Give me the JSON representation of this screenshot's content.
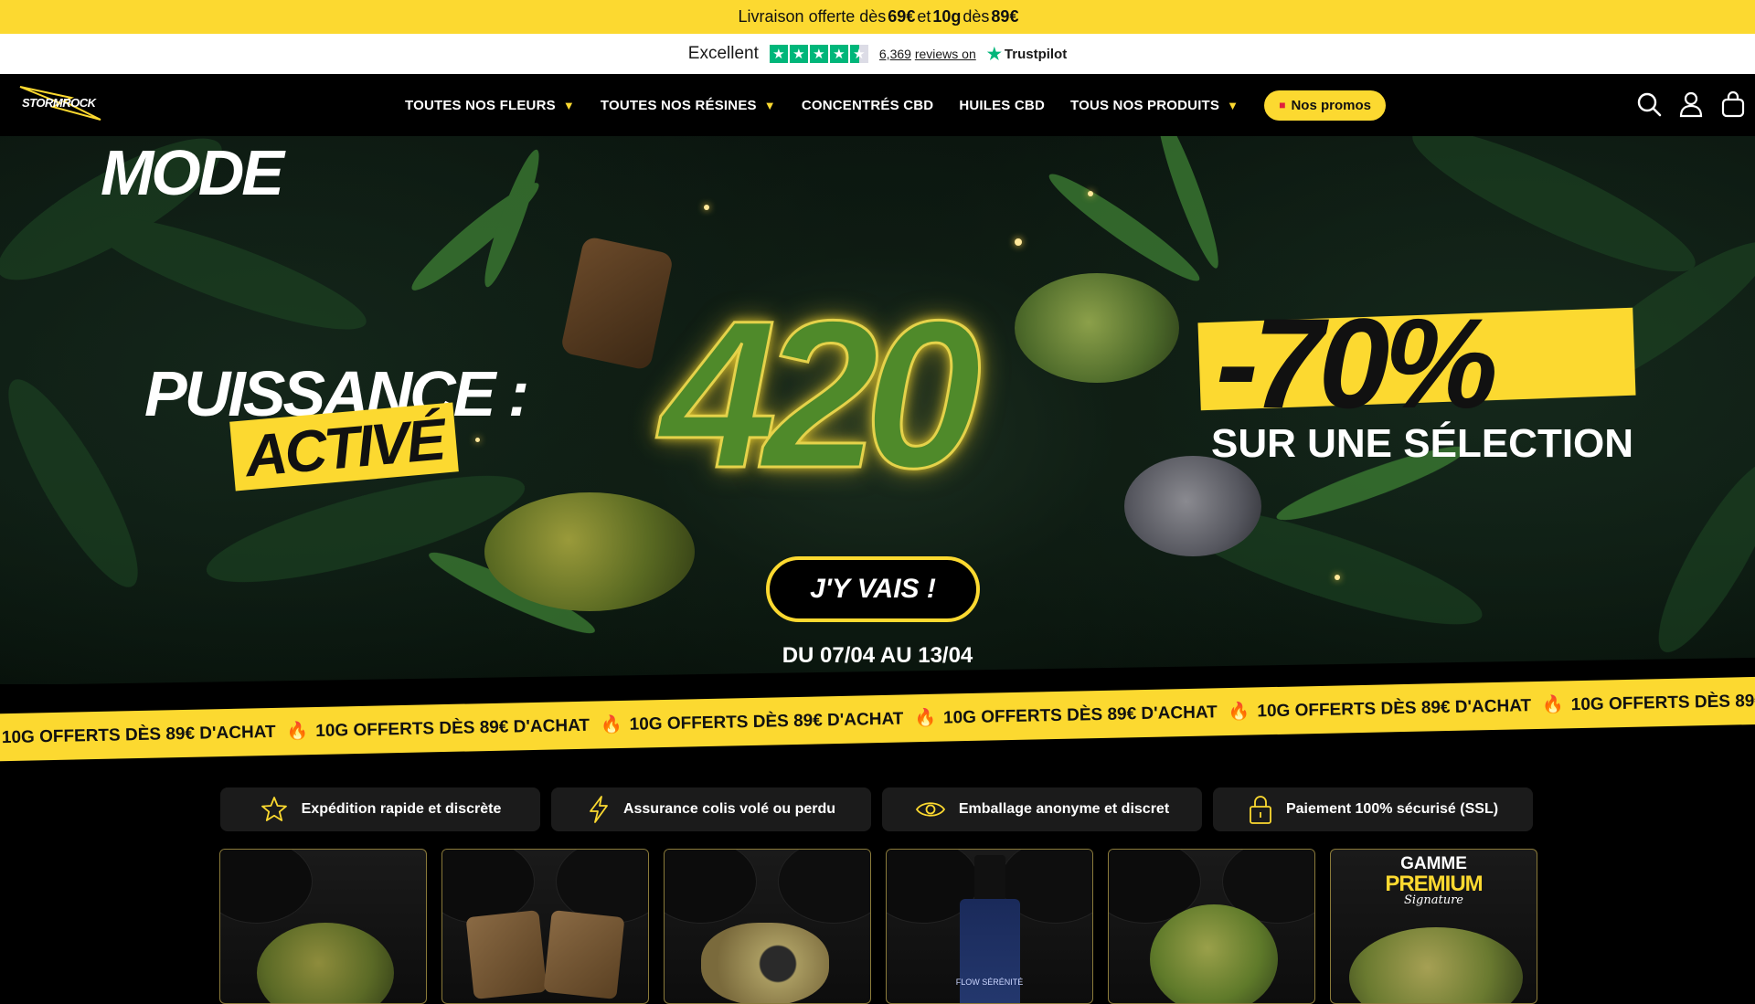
{
  "announcement": {
    "prefix": "Livraison offerte dès",
    "amount1": "69€",
    "mid": "et",
    "qty": "10g",
    "mid2": "dès",
    "amount2": "89€"
  },
  "trustpilot": {
    "rating_label": "Excellent",
    "stars": 4.5,
    "review_count": "6,369",
    "reviews_text": "reviews on",
    "brand": "Trustpilot"
  },
  "header": {
    "logo_text": "STORMROCK",
    "nav": [
      {
        "label": "TOUTES NOS FLEURS",
        "dropdown": true
      },
      {
        "label": "TOUTES NOS RÉSINES",
        "dropdown": true
      },
      {
        "label": "CONCENTRÉS CBD",
        "dropdown": false
      },
      {
        "label": "HUILES CBD",
        "dropdown": false
      },
      {
        "label": "TOUS NOS PRODUITS",
        "dropdown": true
      }
    ],
    "promo_label": "Nos promos",
    "icons": [
      "search-icon",
      "account-icon",
      "cart-icon"
    ]
  },
  "hero": {
    "line1": "MODE",
    "line2": "PUISSANCE :",
    "line3": "ACTIVÉ",
    "number": "420",
    "discount": "-70%",
    "discount_sub": "SUR UNE SÉLECTION",
    "cta": "J'Y VAIS !",
    "dates": "DU 07/04 AU 13/04"
  },
  "ticker": {
    "text": "10G OFFERTS DÈS 89€ D'ACHAT",
    "icon": "fire-icon"
  },
  "features": [
    {
      "icon": "star-icon",
      "label": "Expédition rapide et discrète"
    },
    {
      "icon": "lightning-icon",
      "label": "Assurance colis volé ou perdu"
    },
    {
      "icon": "eye-icon",
      "label": "Emballage anonyme et discret"
    },
    {
      "icon": "lock-icon",
      "label": "Paiement 100% sécurisé (SSL)"
    }
  ],
  "products": [
    {
      "type": "flower"
    },
    {
      "type": "resin"
    },
    {
      "type": "filled-resin"
    },
    {
      "type": "oil",
      "label": "FLOW SÉRÉNITÉ"
    },
    {
      "type": "flower"
    },
    {
      "type": "premium",
      "title": "GAMME",
      "subtitle": "PREMIUM",
      "signature": "Signature"
    }
  ],
  "colors": {
    "accent": "#fcd930",
    "background": "#000000",
    "trustpilot_green": "#00b67a"
  }
}
